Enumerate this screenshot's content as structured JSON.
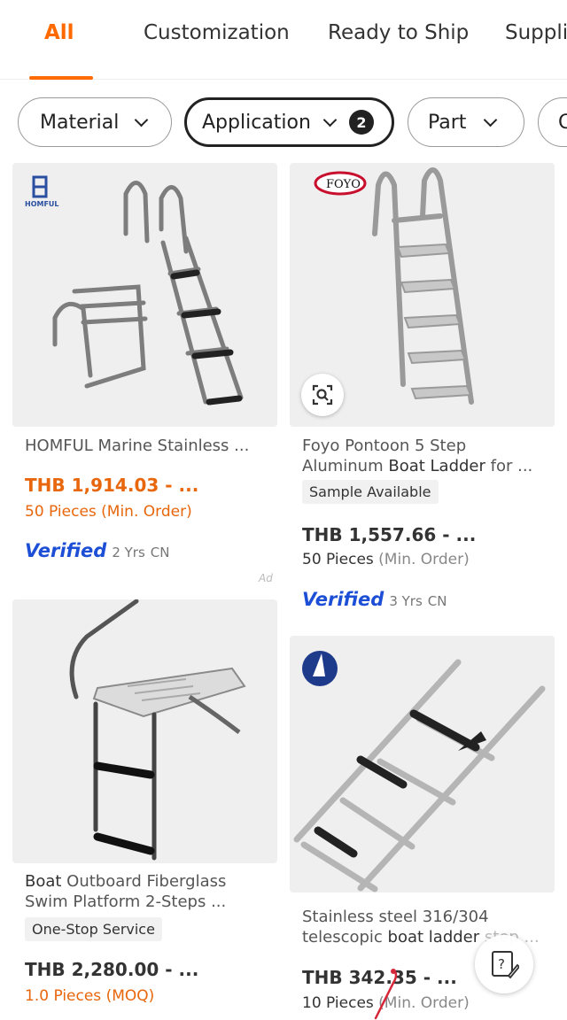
{
  "tabs": [
    {
      "label": "All"
    },
    {
      "label": "Customization"
    },
    {
      "label": "Ready to Ship"
    },
    {
      "label": "Supplie"
    }
  ],
  "filters": [
    {
      "label": "Material"
    },
    {
      "label": "Application",
      "count": "2"
    },
    {
      "label": "Part"
    },
    {
      "label": "C"
    }
  ],
  "products": [
    {
      "brand_logo": "HOMFUL",
      "title": "HOMFUL Marine Stainless ...",
      "price": "THB 1,914.03 - ...",
      "moq": "50 Pieces (Min. Order)",
      "verified": "Verified",
      "years": "2 Yrs",
      "country": "CN",
      "ad": "Ad",
      "price_color": "#e8660c"
    },
    {
      "brand_logo": "FOYO",
      "title_line1": "Foyo Pontoon 5 Step",
      "title_line2_pre": "Aluminum ",
      "title_line2_bold": "Boat Ladder",
      "title_line2_post": " for ...",
      "tag": "Sample Available",
      "price": "THB 1,557.66 - ...",
      "moq_value": "50 Pieces",
      "moq_unit": " (Min. Order)",
      "verified": "Verified",
      "years": "3 Yrs",
      "country": "CN"
    },
    {
      "title_line1_bold": "Boat",
      "title_line1_post": " Outboard Fiberglass",
      "title_line2": "Swim Platform 2-Steps ...",
      "tag": "One-Stop Service",
      "price": "THB 2,280.00 - ...",
      "moq": "1.0 Pieces (MOQ)",
      "price_color": "#e8660c"
    },
    {
      "title_line1": "Stainless steel 316/304",
      "title_line2_pre": "telescopic ",
      "title_line2_bold": "boat ladder",
      "title_line2_post": " step ...",
      "price": "THB 342.35 - ...",
      "moq_value": "10 Pieces",
      "moq_unit": " (Min. Order)"
    }
  ],
  "icons": {
    "image_search": "image-search-icon",
    "help": "help-edit-icon"
  },
  "colors": {
    "accent": "#ff6a00",
    "verified": "#1c4fd6"
  }
}
